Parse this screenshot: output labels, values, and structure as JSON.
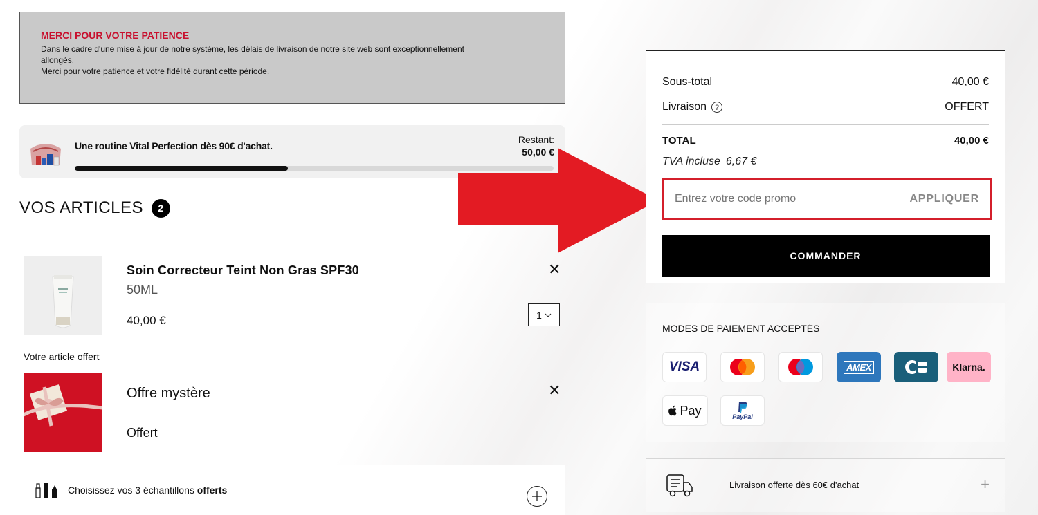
{
  "notice": {
    "title": "MERCI POUR VOTRE PATIENCE",
    "line1": "Dans le cadre d'une mise à jour de notre système, les délais de livraison de notre site web sont exceptionnellement",
    "line2": "allongés.",
    "line3": "Merci pour votre patience et votre fidélité durant cette période."
  },
  "promo": {
    "text": "Une routine Vital Perfection dès 90€ d'achat.",
    "remaining_label": "Restant:",
    "remaining_value": "50,00 €",
    "progress": 0.445
  },
  "articles": {
    "heading": "VOS ARTICLES",
    "count": "2",
    "item1": {
      "name": "Soin Correcteur Teint Non Gras SPF30",
      "size": "50ML",
      "price": "40,00 €",
      "qty": "1"
    },
    "offered_label": "Votre article offert",
    "item2": {
      "name": "Offre mystère",
      "price": "Offert"
    },
    "close_glyph": "✕",
    "samples_prefix": "Choisissez vos 3 échantillons ",
    "samples_bold": "offerts"
  },
  "summary": {
    "subtotal_label": "Sous-total",
    "subtotal_value": "40,00 €",
    "shipping_label": "Livraison",
    "shipping_value": "OFFERT",
    "total_label": "TOTAL",
    "total_value": "40,00 €",
    "tva_label": "TVA incluse",
    "tva_value": "6,67 €",
    "promo_placeholder": "Entrez votre code promo",
    "apply_label": "APPLIQUER",
    "order_label": "COMMANDER"
  },
  "payments": {
    "title": "MODES DE PAIEMENT ACCEPTÉS",
    "visa": "VISA",
    "amex": "AMEX",
    "klarna": "Klarna.",
    "applepay": "Pay",
    "paypal": "PayPal"
  },
  "delivery": {
    "label": "Livraison offerte dès 60€ d'achat",
    "plus": "+"
  },
  "colors": {
    "accent_red": "#d41f2b",
    "notice_title": "#c8102e",
    "arrow": "#e31b23",
    "amex_blue": "#2e77bc",
    "cb_blue": "#1a5f7a",
    "klarna_pink": "#ffb3c7"
  }
}
